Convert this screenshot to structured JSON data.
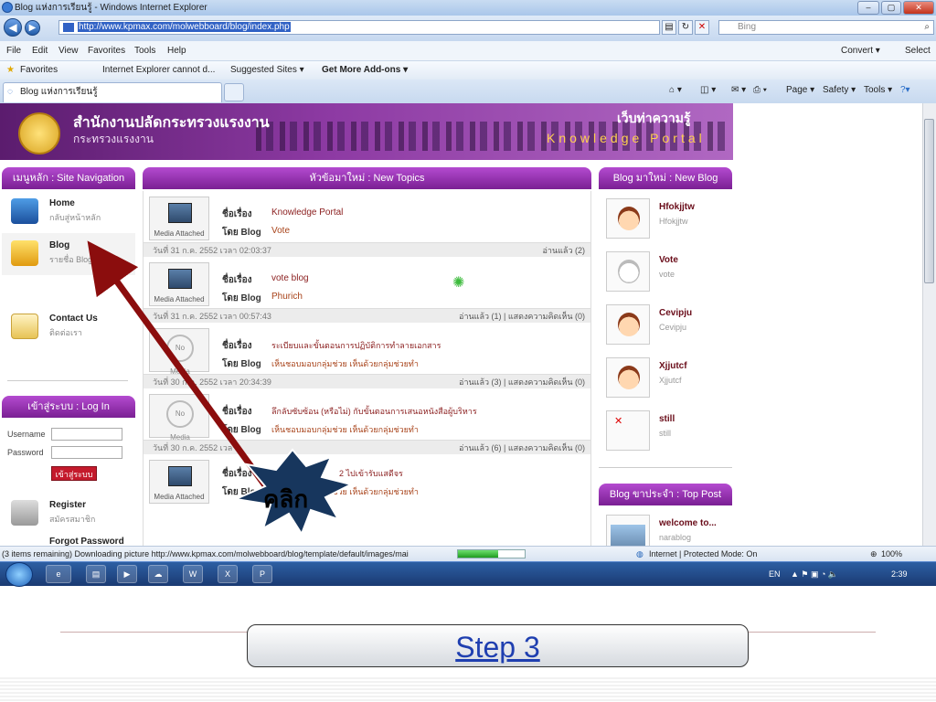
{
  "window": {
    "title": "Blog แห่งการเรียนรู้ - Windows Internet Explorer",
    "controls": [
      "–",
      "▢",
      "✕"
    ]
  },
  "address": {
    "url": "http://www.kpmax.com/molwebboard/blog/index.php",
    "search_placeholder": "Bing"
  },
  "menu": {
    "items": [
      "File",
      "Edit",
      "View",
      "Favorites",
      "Tools",
      "Help"
    ],
    "right": [
      "Convert ▾",
      "Select"
    ]
  },
  "favorites": {
    "label": "Favorites",
    "items": [
      "Internet Explorer cannot d...",
      "Suggested Sites ▾",
      "Get More Add-ons ▾"
    ]
  },
  "tab": {
    "label": "Blog แห่งการเรียนรู้",
    "tools": [
      "Page ▾",
      "Safety ▾",
      "Tools ▾"
    ]
  },
  "banner": {
    "org_th": "สำนักงานปลัดกระทรวงแรงงาน",
    "org_sub": "กระทรวงแรงงาน",
    "portal_th": "เว็บท่าความรู้",
    "portal_en": "Knowledge Portal"
  },
  "nav": {
    "header": "เมนูหลัก : Site Navigation",
    "items": [
      {
        "title": "Home",
        "sub": "กลับสู่หน้าหลัก"
      },
      {
        "title": "Blog",
        "sub": "รายชื่อ Blog"
      },
      {
        "title": "Contact Us",
        "sub": "ติดต่อเรา"
      }
    ]
  },
  "login": {
    "header": "เข้าสู่ระบบ : Log In",
    "username_label": "Username",
    "password_label": "Password",
    "button": "เข้าสู่ระบบ",
    "register_title": "Register",
    "register_sub": "สมัครสมาชิก",
    "forgot_title": "Forgot Password"
  },
  "topics": {
    "header": "หัวข้อมาใหม่ : New Topics",
    "subject_label": "ชื่อเรื่อง",
    "by_label": "โดย Blog",
    "items": [
      {
        "media": "Media Attached",
        "title": "Knowledge Portal",
        "by": "Vote",
        "date": "วันที่ 31 ก.ค. 2552 เวลา 02:03:37",
        "stats": "อ่านแล้ว (2)"
      },
      {
        "media": "Media Attached",
        "title": "vote blog",
        "by": "Phurich",
        "date": "วันที่ 31 ก.ค. 2552 เวลา 00:57:43",
        "stats": "อ่านแล้ว (1)  |  แสดงความคิดเห็น (0)"
      },
      {
        "media": "No Media",
        "title": "ระเบียบและขั้นตอนการปฏิบัติการทำลายเอกสาร",
        "by": "เห็นชอบมอบกลุ่มช่วย เห็นด้วยกลุ่มช่วยทำ",
        "date": "วันที่ 30 ก.ค. 2552 เวลา 20:34:39",
        "stats": "อ่านแล้ว (3)  |  แสดงความคิดเห็น (0)"
      },
      {
        "media": "No Media",
        "title": "ลึกลับซับซ้อน (หรือไม่) กับขั้นตอนการเสนอหนังสือผู้บริหาร",
        "by": "เห็นชอบมอบกลุ่มช่วย เห็นด้วยกลุ่มช่วยทำ",
        "date": "วันที่ 30 ก.ค. 2552 เวลา",
        "stats": "อ่านแล้ว (6)  |  แสดงความคิดเห็น (0)"
      },
      {
        "media": "Media Attached",
        "title": "2 ไปเข้ารับแสดีจร",
        "by": "เห็นชอบมอบกลุ่มช่วย เห็นด้วยกลุ่มช่วยทำ",
        "date": "",
        "stats": ""
      }
    ]
  },
  "blogs": {
    "header": "Blog มาใหม่ : New Blog",
    "items": [
      {
        "name": "Hfokjjtw",
        "sub": "Hfokjjtw"
      },
      {
        "name": "Vote",
        "sub": "vote"
      },
      {
        "name": "Cevipju",
        "sub": "Cevipju"
      },
      {
        "name": "Xjjutcf",
        "sub": "Xjjutcf"
      },
      {
        "name": "still",
        "sub": "still"
      }
    ],
    "top_header": "Blog ขาประจำ : Top Post",
    "top_item": {
      "name": "welcome to...",
      "sub": "narablog"
    }
  },
  "status": {
    "text": "(3 items remaining) Downloading picture http://www.kpmax.com/molwebboard/blog/template/default/images/mai",
    "progress": 0.6,
    "zone": "Internet | Protected Mode: On",
    "zoom": "100%"
  },
  "taskbar": {
    "lang": "EN",
    "clock": "2:39"
  },
  "annotation": {
    "callout": "คลิก",
    "arrow_color": "#8b0d0d",
    "star_color": "#17365d"
  },
  "slide": {
    "step_label": "Step 3"
  },
  "colors": {
    "banner_purple": "#7a1f93",
    "login_red": "#c41a2c",
    "link_blue": "#1f3fb0"
  }
}
